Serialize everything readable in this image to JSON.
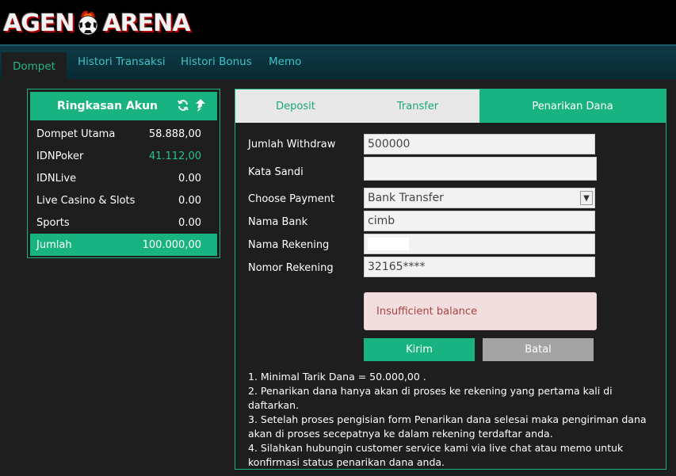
{
  "brand": {
    "logo_left": "AGEN",
    "logo_right": "ARENA"
  },
  "nav": {
    "tabs": [
      "Dompet",
      "Histori Transaksi",
      "Histori Bonus",
      "Memo"
    ]
  },
  "summary": {
    "title": "Ringkasan Akun",
    "rows": [
      {
        "label": "Dompet Utama",
        "value": "58.888,00"
      },
      {
        "label": "IDNPoker",
        "value": "41.112,00"
      },
      {
        "label": "IDNLive",
        "value": "0.00"
      },
      {
        "label": "Live Casino & Slots",
        "value": "0.00"
      },
      {
        "label": "Sports",
        "value": "0.00"
      }
    ],
    "total": {
      "label": "Jumlah",
      "value": "100.000,00"
    }
  },
  "form_tabs": [
    "Deposit",
    "Transfer",
    "Penarikan Dana"
  ],
  "form": {
    "withdraw_label": "Jumlah Withdraw",
    "withdraw_value": "500000",
    "password_label": "Kata Sandi",
    "password_value": "",
    "payment_label": "Choose Payment",
    "payment_value": "Bank Transfer",
    "bank_label": "Nama Bank",
    "bank_value": "cimb",
    "account_name_label": "Nama Rekening",
    "account_no_label": "Nomor Rekening",
    "account_no_value": "32165****"
  },
  "alert": "Insufficient balance",
  "buttons": {
    "submit": "Kirim",
    "cancel": "Batal"
  },
  "notes": [
    "1. Minimal Tarik Dana = 50.000,00 .",
    "2. Penarikan dana hanya akan di proses ke rekening yang pertama kali di daftarkan.",
    "3. Setelah proses pengisian form Penarikan dana selesai maka pengiriman dana akan di proses secepatnya ke dalam rekening terdaftar anda.",
    "4. Silahkan hubungin customer service kami via live chat atau memo untuk konfirmasi status penarikan dana anda."
  ],
  "colors": {
    "accent": "#19b382",
    "nav_text": "#3cc3c7",
    "alert_bg": "#f2dede",
    "alert_text": "#a94442"
  }
}
